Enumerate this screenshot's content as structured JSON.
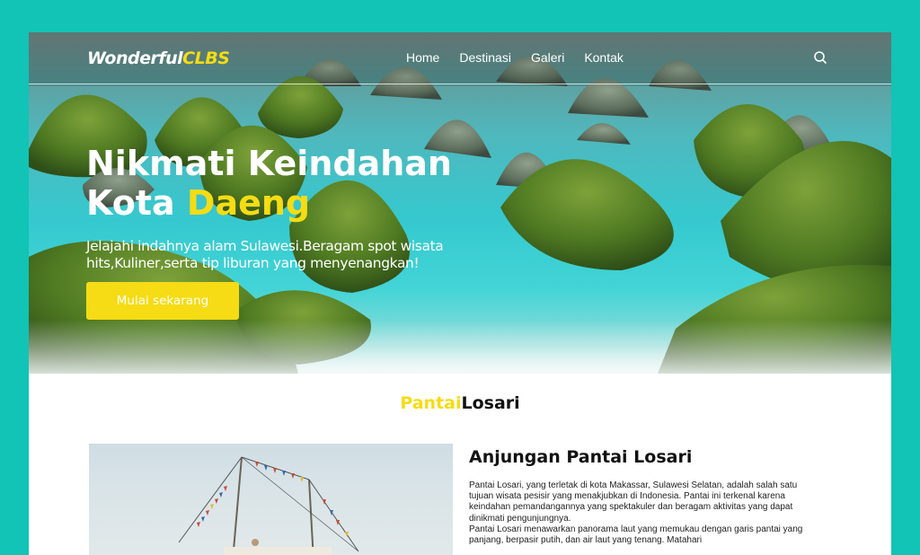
{
  "nav": {
    "logo_main": "Wonderful",
    "logo_accent": "CLBS",
    "links": [
      "Home",
      "Destinasi",
      "Galeri",
      "Kontak"
    ],
    "search_icon": "search-icon"
  },
  "hero": {
    "title_line1": "Nikmati Keindahan",
    "title_line2_main": "Kota ",
    "title_line2_accent": "Daeng",
    "subtitle": "Jelajahi indahnya alam Sulawesi.Beragam spot wisata hits,Kuliner,serta tip liburan yang menyenangkan!",
    "cta_label": "Mulai sekarang"
  },
  "section": {
    "title_accent": "Pantai",
    "title_main": "Losari"
  },
  "article": {
    "title": "Anjungan Pantai Losari",
    "paragraph1": "Pantai Losari, yang terletak di kota Makassar, Sulawesi Selatan, adalah salah satu tujuan wisata pesisir yang menakjubkan di Indonesia. Pantai ini terkenal karena keindahan pemandangannya yang spektakuler dan beragam aktivitas yang dapat dinikmati pengunjungnya.",
    "paragraph2": "Pantai Losari menawarkan panorama laut yang memukau dengan garis pantai yang panjang, berpasir putih, dan air laut yang tenang. Matahari"
  },
  "colors": {
    "background": "#11c4b6",
    "accent": "#f5dc14",
    "text_dark": "#111111",
    "white": "#ffffff"
  }
}
